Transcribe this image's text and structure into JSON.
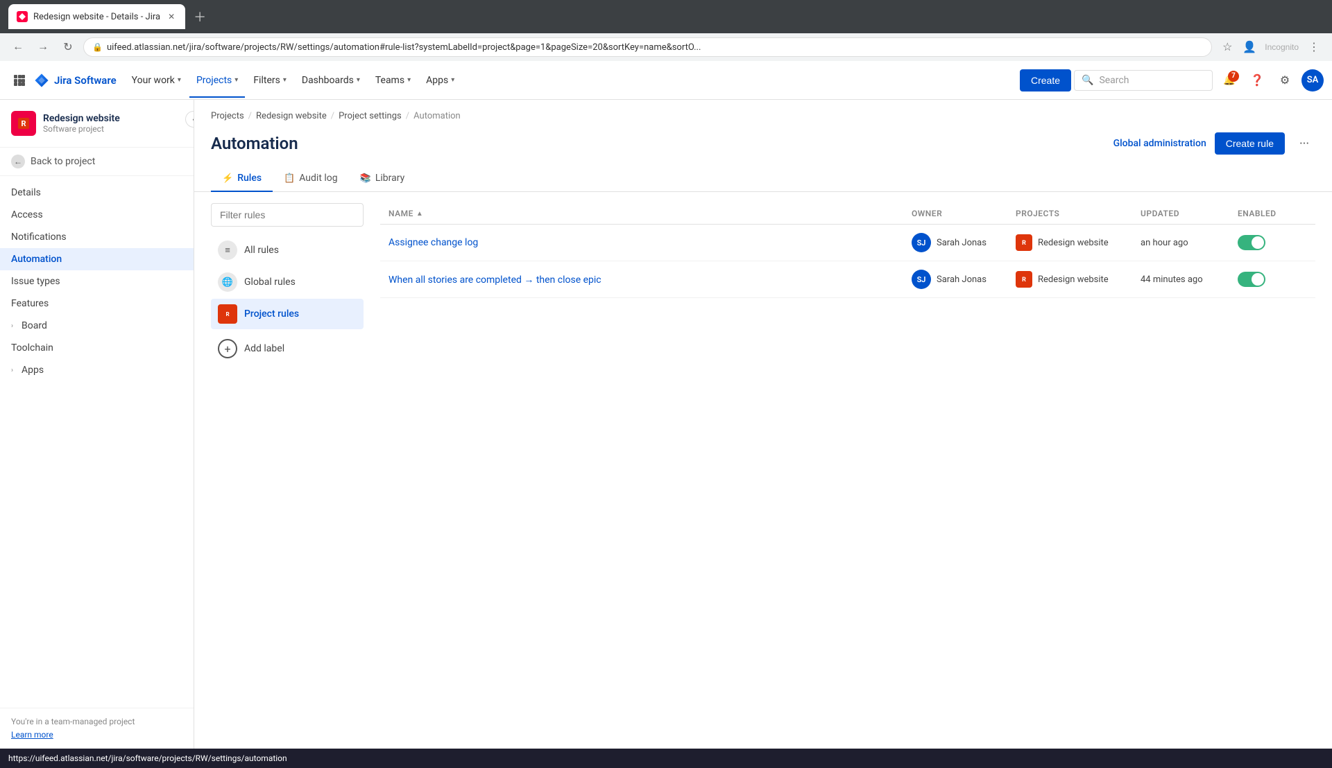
{
  "browser": {
    "tab_title": "Redesign website - Details - Jira",
    "url": "uifeed.atlassian.net/jira/software/projects/RW/settings/automation#rule-list?systemLabelId=project&page=1&pageSize=20&sortKey=name&sortO...",
    "incognito_label": "Incognito"
  },
  "topnav": {
    "logo_text": "Jira Software",
    "your_work": "Your work",
    "projects": "Projects",
    "filters": "Filters",
    "dashboards": "Dashboards",
    "teams": "Teams",
    "apps": "Apps",
    "create": "Create",
    "search_placeholder": "Search",
    "notification_count": "7",
    "avatar_initials": "SA"
  },
  "sidebar": {
    "project_name": "Redesign website",
    "project_type": "Software project",
    "project_icon_text": "R",
    "back_to_project": "Back to project",
    "nav_items": [
      {
        "label": "Details",
        "active": false
      },
      {
        "label": "Access",
        "active": false
      },
      {
        "label": "Notifications",
        "active": false
      },
      {
        "label": "Automation",
        "active": true
      },
      {
        "label": "Issue types",
        "active": false
      },
      {
        "label": "Features",
        "active": false
      },
      {
        "label": "Board",
        "active": false,
        "expandable": true
      },
      {
        "label": "Toolchain",
        "active": false
      },
      {
        "label": "Apps",
        "active": false,
        "expandable": true
      }
    ],
    "footer_text": "You're in a team-managed project",
    "learn_more": "Learn more"
  },
  "breadcrumb": [
    {
      "label": "Projects"
    },
    {
      "label": "Redesign website"
    },
    {
      "label": "Project settings"
    },
    {
      "label": "Automation"
    }
  ],
  "page": {
    "title": "Automation",
    "global_admin_label": "Global administration",
    "create_rule_label": "Create rule"
  },
  "tabs": [
    {
      "label": "Rules",
      "icon": "⚡",
      "active": true
    },
    {
      "label": "Audit log",
      "icon": "📋",
      "active": false
    },
    {
      "label": "Library",
      "icon": "📚",
      "active": false
    }
  ],
  "filter": {
    "placeholder": "Filter rules"
  },
  "rule_categories": [
    {
      "label": "All rules",
      "type": "all",
      "active": false
    },
    {
      "label": "Global rules",
      "type": "global",
      "active": false
    },
    {
      "label": "Project rules",
      "type": "project",
      "active": true
    }
  ],
  "add_label": "Add label",
  "table": {
    "columns": [
      {
        "label": "Name",
        "sortable": true
      },
      {
        "label": "Owner"
      },
      {
        "label": "Projects"
      },
      {
        "label": "Updated"
      },
      {
        "label": "Enabled"
      }
    ],
    "rows": [
      {
        "name": "Assignee change log",
        "owner_initials": "SJ",
        "owner_name": "Sarah Jonas",
        "project_icon": "R",
        "project_name": "Redesign website",
        "updated": "an hour ago",
        "enabled": true
      },
      {
        "name": "When all stories are completed → then close epic",
        "owner_initials": "SJ",
        "owner_name": "Sarah Jonas",
        "project_icon": "R",
        "project_name": "Redesign website",
        "updated": "44 minutes ago",
        "enabled": true
      }
    ]
  },
  "statusbar": {
    "url": "https://uifeed.atlassian.net/jira/software/projects/RW/settings/automation"
  }
}
